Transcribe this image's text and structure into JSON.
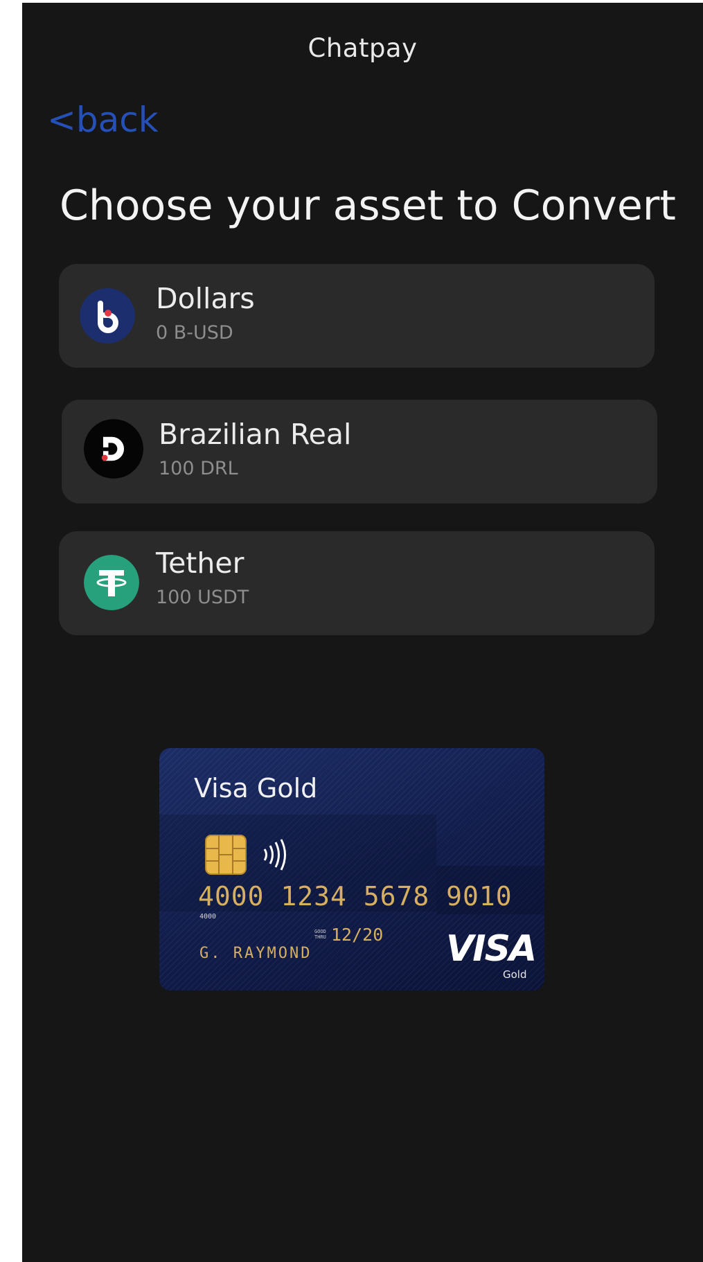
{
  "header": {
    "title": "Chatpay",
    "back_label": "<back"
  },
  "page": {
    "heading": "Choose your asset to Convert"
  },
  "assets": [
    {
      "name": "Dollars",
      "balance": "0 B-USD",
      "icon": "bitso-logo-icon",
      "color": "#1c2e6e"
    },
    {
      "name": "Brazilian Real",
      "balance": "100 DRL",
      "icon": "drl-logo-icon",
      "color": "#000000"
    },
    {
      "name": "Tether",
      "balance": "100 USDT",
      "icon": "tether-logo-icon",
      "color": "#26a17b"
    }
  ],
  "card": {
    "title": "Visa Gold",
    "number": "4000 1234 5678 9010",
    "small_digits": "4000",
    "valid_thru": "GOOD THRU",
    "expiry": "12/20",
    "holder": "G. RAYMOND",
    "brand": "VISA",
    "brand_sub": "Gold"
  },
  "colors": {
    "background": "#161616",
    "tile": "#2a2a2a",
    "link": "#2550b8",
    "card_gold": "#d6b060"
  }
}
